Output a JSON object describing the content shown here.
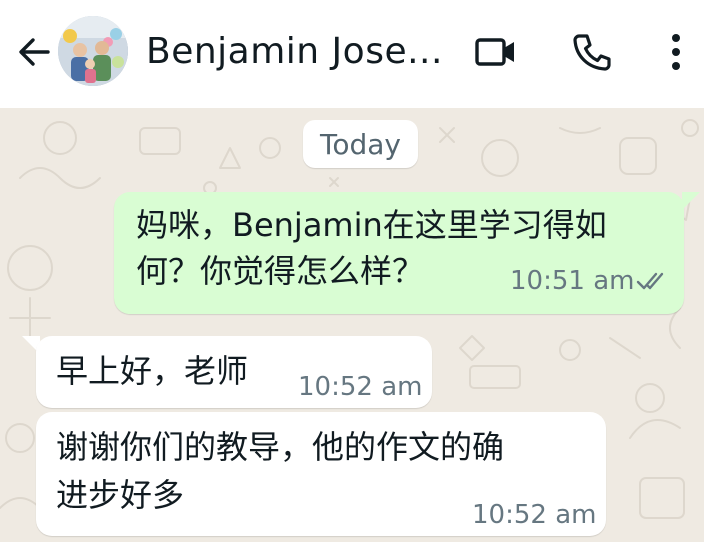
{
  "header": {
    "contact_name": "Benjamin Jose...",
    "icons": [
      "back-arrow-icon",
      "avatar",
      "video-call-icon",
      "voice-call-icon",
      "more-options-icon"
    ]
  },
  "chat": {
    "date_label": "Today",
    "messages": [
      {
        "direction": "outgoing",
        "line1": "妈咪，Benjamin在这里学习得如",
        "line2": "何？你觉得怎么样？",
        "time": "10:51 am",
        "status": "read"
      },
      {
        "direction": "incoming",
        "line1": "早上好，老师",
        "time": "10:52 am"
      },
      {
        "direction": "incoming",
        "line1": "谢谢你们的教导，他的作文的确",
        "line2": "进步好多",
        "time": "10:52 am"
      }
    ]
  },
  "colors": {
    "outgoing_bubble": "#d9fdd3",
    "incoming_bubble": "#ffffff",
    "chat_background": "#efeae2",
    "header_background": "#ffffff",
    "read_tick": "#667781"
  }
}
